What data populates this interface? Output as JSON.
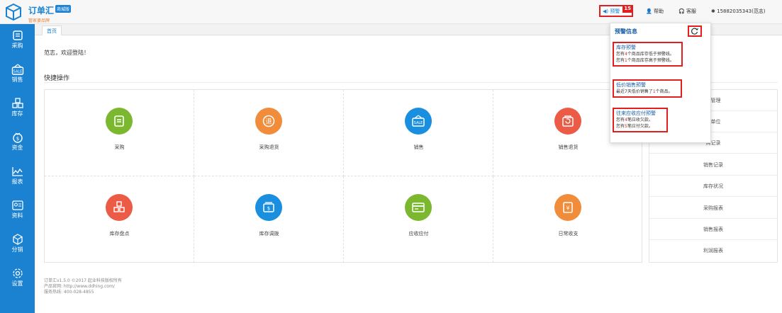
{
  "header": {
    "brand_name": "订单汇",
    "brand_tag": "商城版",
    "brand_sub": "管家婆品牌",
    "alert_label": "预警",
    "alert_count": "15",
    "help_label": "帮助",
    "service_label": "客服",
    "user_label": "15882035343(范志)"
  },
  "sidebar": {
    "items": [
      {
        "label": "采购",
        "icon": "purchase-icon"
      },
      {
        "label": "销售",
        "icon": "sale-icon"
      },
      {
        "label": "库存",
        "icon": "inventory-icon"
      },
      {
        "label": "资金",
        "icon": "fund-icon"
      },
      {
        "label": "报表",
        "icon": "report-icon"
      },
      {
        "label": "资料",
        "icon": "profile-icon"
      },
      {
        "label": "分销",
        "icon": "distribution-icon"
      },
      {
        "label": "设置",
        "icon": "settings-icon"
      }
    ]
  },
  "tabs": [
    {
      "label": "首页"
    }
  ],
  "main": {
    "welcome": "范志，欢迎登陆！",
    "quick_title": "快捷操作",
    "quick_items": [
      {
        "label": "采购",
        "color": "#7cb82f"
      },
      {
        "label": "采购退货",
        "color": "#f08c3a"
      },
      {
        "label": "销售",
        "color": "#1a8fe0"
      },
      {
        "label": "销售退货",
        "color": "#ec5b45"
      },
      {
        "label": "库存盘点",
        "color": "#ec5b45"
      },
      {
        "label": "库存调拨",
        "color": "#1a8fe0"
      },
      {
        "label": "应收应付",
        "color": "#7cb82f"
      },
      {
        "label": "日常收支",
        "color": "#f08c3a"
      }
    ]
  },
  "right_list": {
    "items": [
      "品管理",
      "来单位",
      "购记录",
      "销售记录",
      "库存状况",
      "采购报表",
      "销售报表",
      "利润报表"
    ]
  },
  "footer": {
    "line1": "订单汇v1.5.0  ©2017 起业科技版权所有",
    "line2": "产品官网: http://www.ddhing.com/",
    "line3": "服务热线: 400-028-4855"
  },
  "popup": {
    "title": "预警信息",
    "sections": [
      {
        "title": "库存预警",
        "lines": [
          {
            "pre": "您有",
            "num": "4",
            "post": "个商品库存低于预警线。"
          },
          {
            "pre": "您有",
            "num": "1",
            "post": "个商品库存高于预警线。"
          }
        ]
      },
      {
        "title": "低价销售预警",
        "lines": [
          {
            "pre": "最近7天低价销售了",
            "num": "1",
            "post": "个商品。"
          }
        ]
      },
      {
        "title": "往来应收应付预警",
        "lines": [
          {
            "pre": "您有",
            "num": "4",
            "post": "笔应收欠款。"
          },
          {
            "pre": "您有",
            "num": "5",
            "post": "笔应付欠款。"
          }
        ]
      }
    ]
  },
  "colors": {
    "primary": "#1b82d2",
    "alert": "#e02020"
  }
}
